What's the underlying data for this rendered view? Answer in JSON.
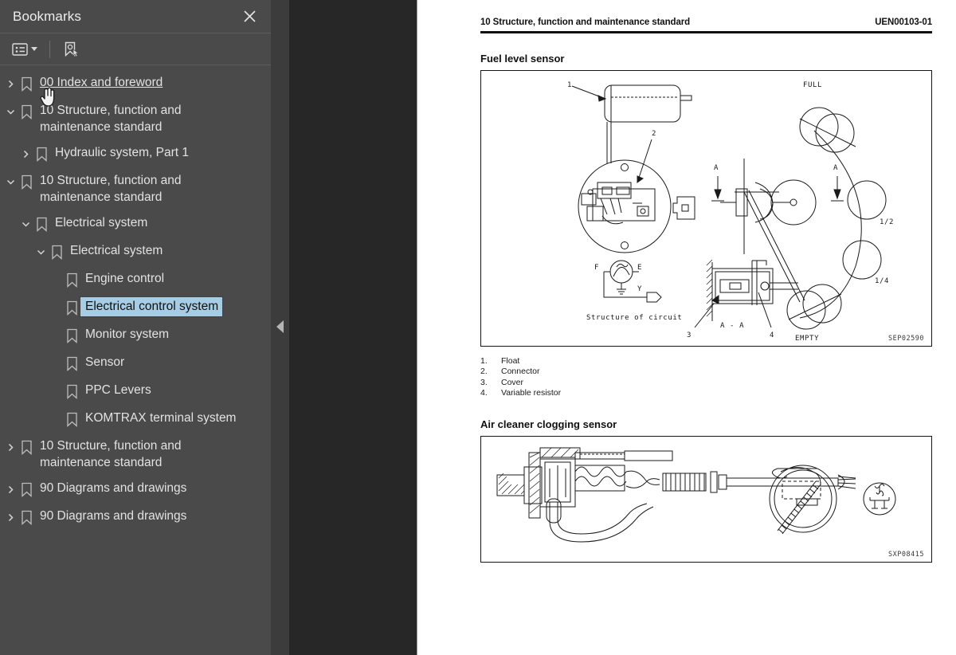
{
  "sidebar": {
    "title": "Bookmarks",
    "close_icon": "close-icon",
    "toolbar": {
      "list_options_label": "list-options",
      "list_options_icon": "list-options-icon",
      "dropdown_icon": "chevron-down-icon",
      "new_bookmark_label": "new-bookmark",
      "new_bookmark_icon": "new-bookmark-icon"
    },
    "collapse_handle_icon": "collapse-left-icon",
    "selected_color": "#a7cde5",
    "panel_color": "#4a4a4a",
    "items": [
      {
        "label": "00 Index and foreword",
        "depth": 0,
        "twisty": "collapsed",
        "selected": false,
        "hovered": true
      },
      {
        "label": "10 Structure, function and maintenance standard",
        "depth": 0,
        "twisty": "expanded",
        "selected": false,
        "hovered": false
      },
      {
        "label": "Hydraulic system, Part 1",
        "depth": 1,
        "twisty": "collapsed",
        "selected": false,
        "hovered": false
      },
      {
        "label": "10 Structure, function and maintenance standard",
        "depth": 0,
        "twisty": "expanded",
        "selected": false,
        "hovered": false
      },
      {
        "label": "Electrical system",
        "depth": 1,
        "twisty": "expanded",
        "selected": false,
        "hovered": false
      },
      {
        "label": "Electrical system",
        "depth": 2,
        "twisty": "expanded",
        "selected": false,
        "hovered": false
      },
      {
        "label": "Engine control",
        "depth": 3,
        "twisty": "none",
        "selected": false,
        "hovered": false
      },
      {
        "label": "Electrical control system",
        "depth": 3,
        "twisty": "none",
        "selected": true,
        "hovered": false
      },
      {
        "label": "Monitor system",
        "depth": 3,
        "twisty": "none",
        "selected": false,
        "hovered": false
      },
      {
        "label": "Sensor",
        "depth": 3,
        "twisty": "none",
        "selected": false,
        "hovered": false
      },
      {
        "label": "PPC Levers",
        "depth": 3,
        "twisty": "none",
        "selected": false,
        "hovered": false
      },
      {
        "label": "KOMTRAX terminal system",
        "depth": 3,
        "twisty": "none",
        "selected": false,
        "hovered": false
      },
      {
        "label": "10 Structure, function and maintenance standard",
        "depth": 0,
        "twisty": "collapsed",
        "selected": false,
        "hovered": false
      },
      {
        "label": "90 Diagrams and drawings",
        "depth": 0,
        "twisty": "collapsed",
        "selected": false,
        "hovered": false
      },
      {
        "label": "90 Diagrams and drawings",
        "depth": 0,
        "twisty": "collapsed",
        "selected": false,
        "hovered": false
      }
    ]
  },
  "page": {
    "header_left": "10 Structure, function and maintenance standard",
    "header_right": "UEN00103-01",
    "section1_title": "Fuel level sensor",
    "figure1_code": "SEP02590",
    "figure1_labels": {
      "callout_1": "1",
      "callout_2": "2",
      "callout_3": "3",
      "callout_4": "4",
      "full": "FULL",
      "half": "1/2",
      "quarter": "1/4",
      "empty": "EMPTY",
      "section_arrow_a_left": "A",
      "section_arrow_a_right": "A",
      "section_view": "A - A",
      "circuit_caption": "Structure of circuit",
      "terminal_f": "F",
      "terminal_e": "E",
      "terminal_y": "Y"
    },
    "legend": [
      {
        "num": "1.",
        "text": "Float"
      },
      {
        "num": "2.",
        "text": "Connector"
      },
      {
        "num": "3.",
        "text": "Cover"
      },
      {
        "num": "4.",
        "text": "Variable resistor"
      }
    ],
    "section2_title": "Air cleaner clogging sensor",
    "figure2_code": "SXP08415"
  },
  "cursor": {
    "icon": "hand-pointer-cursor"
  }
}
